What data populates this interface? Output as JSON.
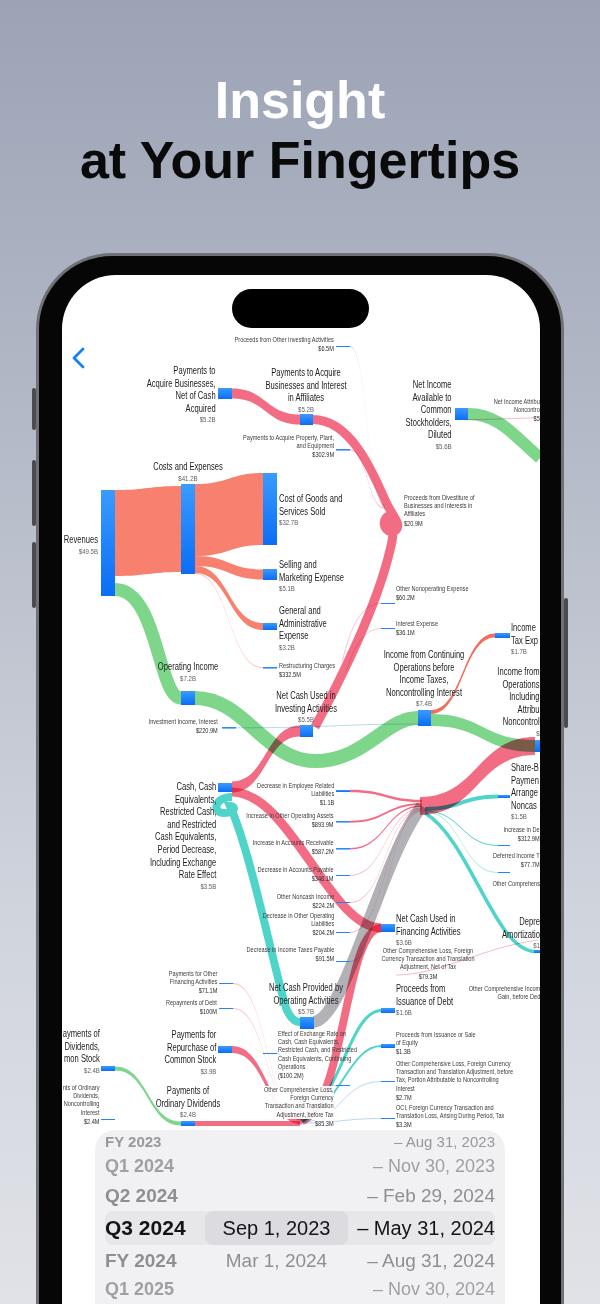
{
  "headline": {
    "title": "Insight",
    "subtitle": "at Your Fingertips"
  },
  "sankey": {
    "nodes": [
      {
        "label": "Proceeds from Other Investing Activities",
        "value": "$6.5M",
        "kind": "minor"
      },
      {
        "label": "Payments to\nAcquire Businesses,\nNet of Cash\nAcquired",
        "value": "$5.2B",
        "kind": "major"
      },
      {
        "label": "Payments to Acquire\nBusinesses and Interest\nin Affiliates",
        "value": "$5.2B",
        "kind": "major"
      },
      {
        "label": "Net Income\nAvailable to\nCommon\nStockholders,\nDiluted",
        "value": "$5.6B",
        "kind": "major"
      },
      {
        "label": "Net Income Attribu\nNoncontro",
        "value": "$5",
        "kind": "minor"
      },
      {
        "label": "Payments to Acquire Property, Plant,\nand Equipment",
        "value": "$302.9M",
        "kind": "minor"
      },
      {
        "label": "Costs and Expenses",
        "value": "$41.2B",
        "kind": "major"
      },
      {
        "label": "Cost of Goods and\nServices Sold",
        "value": "$32.7B",
        "kind": "major"
      },
      {
        "label": "Proceeds from Divestiture of\nBusinesses and Interests in\nAffiliates",
        "value": "$20.9M",
        "kind": "minor"
      },
      {
        "label": "Revenues",
        "value": "$49.5B",
        "kind": "major"
      },
      {
        "label": "Selling and\nMarketing Expense",
        "value": "$5.1B",
        "kind": "major"
      },
      {
        "label": "Other Nonoperating Expense",
        "value": "$60.2M",
        "kind": "minor"
      },
      {
        "label": "General and\nAdministrative\nExpense",
        "value": "$3.2B",
        "kind": "major"
      },
      {
        "label": "Interest Expense",
        "value": "$36.1M",
        "kind": "minor"
      },
      {
        "label": "Income\nTax Exp",
        "value": "$1.7B",
        "kind": "major"
      },
      {
        "label": "Income from Continuing\nOperations before\nIncome Taxes,\nNoncontrolling Interest",
        "value": "$7.4B",
        "kind": "major"
      },
      {
        "label": "Operating Income",
        "value": "$7.2B",
        "kind": "major"
      },
      {
        "label": "Restructuring Charges",
        "value": "$332.5M",
        "kind": "minor"
      },
      {
        "label": "Net Cash Used in\nInvesting Activities",
        "value": "$5.5B",
        "kind": "major"
      },
      {
        "label": "Investment Income, Interest",
        "value": "$220.9M",
        "kind": "minor"
      },
      {
        "label": "Income from\nOperations\nIncluding\nAttribu\nNoncontrol",
        "value": "$",
        "kind": "major"
      },
      {
        "label": "Share-B\nPaymen\nArrange\nNoncas",
        "value": "$1.5B",
        "kind": "major"
      },
      {
        "label": "Cash, Cash\nEquivalents,\nRestricted Cash,\nand Restricted\nCash Equivalents,\nPeriod Decrease,\nIncluding Exchange\nRate Effect",
        "value": "$3.5B",
        "kind": "major"
      },
      {
        "label": "Decrease in Employee Related\nLiabilities",
        "value": "$1.1B",
        "kind": "minor"
      },
      {
        "label": "Increase in Other Operating Assets",
        "value": "$893.9M",
        "kind": "minor"
      },
      {
        "label": "Increase in De",
        "value": "$312.9M",
        "kind": "minor"
      },
      {
        "label": "Increase in Accounts Receivable",
        "value": "$587.2M",
        "kind": "minor"
      },
      {
        "label": "Deferred Income T",
        "value": "$77.7M",
        "kind": "minor"
      },
      {
        "label": "Decrease in Accounts Payable",
        "value": "$348.1M",
        "kind": "minor"
      },
      {
        "label": "Other Comprehens",
        "kind": "minor"
      },
      {
        "label": "Other Noncash Income",
        "value": "$224.2M",
        "kind": "minor"
      },
      {
        "label": "Decrease in Other Operating\nLiabilities",
        "value": "$204.2M",
        "kind": "minor"
      },
      {
        "label": "Net Cash Used in\nFinancing Activities",
        "value": "$3.6B",
        "kind": "major"
      },
      {
        "label": "Depre\nAmortizatio",
        "value": "$1",
        "kind": "major"
      },
      {
        "label": "Decrease in Income Taxes Payable",
        "value": "$91.5M",
        "kind": "minor"
      },
      {
        "label": "Other Comprehensive Loss, Foreign\nCurrency Transaction and Translation\nAdjustment, Net of Tax",
        "value": "$79.3M",
        "kind": "minor"
      },
      {
        "label": "Payments for Other\nFinancing Activities",
        "value": "$71.1M",
        "kind": "minor"
      },
      {
        "label": "Repayments of Debt",
        "value": "$100M",
        "kind": "minor"
      },
      {
        "label": "Net Cash Provided by\nOperating Activities",
        "value": "$5.7B",
        "kind": "major"
      },
      {
        "label": "Proceeds from\nIssuance of Debt",
        "value": "$1.6B",
        "kind": "major"
      },
      {
        "label": "Other Comprehensive Incom\nGain, before Ded",
        "kind": "minor"
      },
      {
        "label": "ayments of\nDividends,\nmon Stock",
        "value": "$2.4B",
        "kind": "major"
      },
      {
        "label": "Payments for\nRepurchase of\nCommon Stock",
        "value": "$3.9B",
        "kind": "major"
      },
      {
        "label": "Effect of Exchange Rate on\nCash, Cash Equivalents,\nRestricted Cash, and Restricted\nCash Equivalents, Continuing\nOperations",
        "value": "($100.2M)",
        "kind": "minor"
      },
      {
        "label": "Proceeds from Issuance or Sale\nof Equity",
        "value": "$1.3B",
        "kind": "minor"
      },
      {
        "label": "Other Comprehensive Loss, Foreign Currency\nTransaction and Translation Adjustment, before\nTax, Portion Attributable to Noncontrolling\nInterest",
        "value": "$2.7M",
        "kind": "minor"
      },
      {
        "label": "nts of Ordinary\nDividends,\nNoncontrolling\nInterest",
        "value": "$2.4M",
        "kind": "minor"
      },
      {
        "label": "Payments of\nOrdinary Dividends",
        "value": "$2.4B",
        "kind": "major"
      },
      {
        "label": "Other Comprehensive Loss,\nForeign Currency\nTransaction and Translation\nAdjustment, before Tax",
        "value": "$85.3M",
        "kind": "minor"
      },
      {
        "label": "OCI, Foreign Currency Transaction and\nTranslation Loss, Arising During Period, Tax",
        "value": "$3.3M",
        "kind": "minor"
      }
    ],
    "links": [
      {
        "kind": "expense"
      },
      {
        "kind": "income"
      },
      {
        "kind": "expense"
      },
      {
        "kind": "expense"
      },
      {
        "kind": "expense"
      },
      {
        "kind": "minor-expense"
      },
      {
        "kind": "income"
      },
      {
        "kind": "minor-inflow"
      },
      {
        "kind": "tax"
      },
      {
        "kind": "income"
      },
      {
        "kind": "income"
      },
      {
        "kind": "minor-outflow"
      },
      {
        "kind": "outflow"
      },
      {
        "kind": "outflow"
      },
      {
        "kind": "outflow"
      },
      {
        "kind": "outflow"
      },
      {
        "kind": "inflow"
      },
      {
        "kind": "transfer"
      },
      {
        "kind": "outflow"
      },
      {
        "kind": "outflow"
      },
      {
        "kind": "outflow"
      },
      {
        "kind": "outflow"
      },
      {
        "kind": "minor-outflow"
      },
      {
        "kind": "minor-outflow"
      },
      {
        "kind": "minor-outflow"
      },
      {
        "kind": "minor-outflow"
      },
      {
        "kind": "inflow"
      },
      {
        "kind": "inflow"
      },
      {
        "kind": "minor-noncash"
      },
      {
        "kind": "inflow"
      },
      {
        "kind": "income"
      },
      {
        "kind": "outflow"
      },
      {
        "kind": "outflow"
      },
      {
        "kind": "outflow"
      },
      {
        "kind": "inflow"
      },
      {
        "kind": "inflow"
      },
      {
        "kind": "minor-outflow"
      },
      {
        "kind": "minor-outflow"
      },
      {
        "kind": "minor-inflow"
      },
      {
        "kind": "minor-outflow"
      },
      {
        "kind": "minor-outflow"
      },
      {
        "kind": "minor-outflow"
      },
      {
        "kind": "minor-outflow"
      },
      {
        "kind": "minor-inflow"
      },
      {
        "kind": "minor-outflow"
      },
      {
        "kind": "minor-inflow"
      },
      {
        "kind": "minor-inflow"
      }
    ]
  },
  "period_picker": {
    "periods": [
      {
        "text": "FY 2023",
        "selected": false
      },
      {
        "text": "Q1 2024",
        "selected": false
      },
      {
        "text": "Q2 2024",
        "selected": false
      },
      {
        "text": "Q3 2024",
        "selected": true
      },
      {
        "text": "FY 2024",
        "selected": false
      },
      {
        "text": "Q1 2025",
        "selected": false
      }
    ],
    "start_dates": [
      {
        "text": "Sep 1, 2023",
        "selected": true
      },
      {
        "text": "Mar 1, 2024",
        "selected": false
      }
    ],
    "end_dates": [
      {
        "text": "– Aug 31, 2023",
        "selected": false
      },
      {
        "text": "– Nov 30, 2023",
        "selected": false
      },
      {
        "text": "– Feb 29, 2024",
        "selected": false
      },
      {
        "text": "– May 31, 2024",
        "selected": true
      },
      {
        "text": "– Aug 31, 2024",
        "selected": false
      },
      {
        "text": "– Nov 30, 2024",
        "selected": false
      }
    ]
  }
}
